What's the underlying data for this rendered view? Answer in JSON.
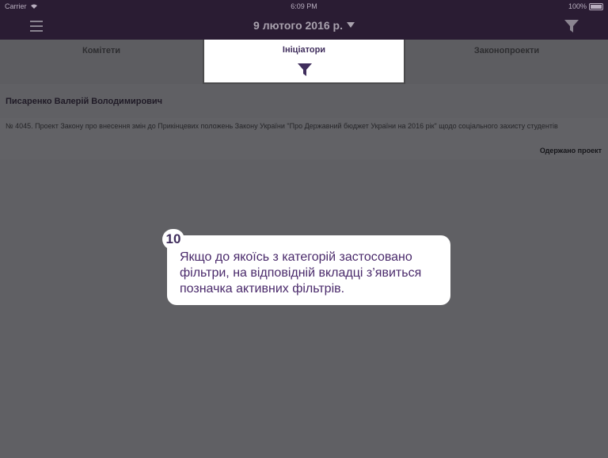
{
  "status_bar": {
    "carrier": "Carrier",
    "time": "6:09 PM",
    "battery": "100%"
  },
  "nav": {
    "date": "9 лютого 2016 р.",
    "menu_icon": "hamburger-icon",
    "filter_icon": "filter-icon"
  },
  "tabs": [
    {
      "label": "Комітети",
      "active": false
    },
    {
      "label": "Ініціатори",
      "active": true,
      "filter_badge": "filter-icon"
    },
    {
      "label": "Законопроекти",
      "active": false
    }
  ],
  "content": {
    "person_name": "Писаренко Валерій Володимирович",
    "items": [
      {
        "text": "№ 4045. Проект Закону про внесення змін до Прикінцевих положень Закону України \"Про Державний бюджет України на 2016 рік\" щодо соціального захисту студентів",
        "status": "Одержано проект"
      }
    ]
  },
  "tooltip": {
    "number": "10",
    "text": "Якщо до якоїсь з категорій застосовано фільтри, на відповідній вкладці з’явиться позначка активних фільтрів."
  },
  "colors": {
    "nav_bg": "#2a1c33",
    "accent": "#3f2d5c",
    "tooltip_text": "#4a2a6b",
    "overlay": "#606064"
  }
}
